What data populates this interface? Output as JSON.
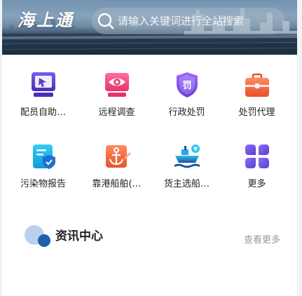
{
  "header": {
    "logo_text": "海上通",
    "search_placeholder": "请输入关键词进行全站搜索"
  },
  "services": [
    {
      "label": "配员自助…",
      "icon": "crew-self-service-icon"
    },
    {
      "label": "远程调查",
      "icon": "remote-survey-icon"
    },
    {
      "label": "行政处罚",
      "icon": "administrative-penalty-icon"
    },
    {
      "label": "处罚代理",
      "icon": "penalty-agent-icon"
    },
    {
      "label": "污染物报告",
      "icon": "pollutant-report-icon"
    },
    {
      "label": "靠港船舶(…",
      "icon": "berthing-ship-icon"
    },
    {
      "label": "货主选船…",
      "icon": "cargo-owner-ship-selection-icon"
    },
    {
      "label": "更多",
      "icon": "more-icon"
    }
  ],
  "news": {
    "title": "资讯中心",
    "more_label": "查看更多"
  },
  "colors": {
    "purple": "#5a3ec8",
    "pink": "#f0457e",
    "violet": "#7a4de0",
    "orange": "#f26a3e",
    "cyan": "#1ab5e8",
    "navy": "#1f4ea3"
  }
}
